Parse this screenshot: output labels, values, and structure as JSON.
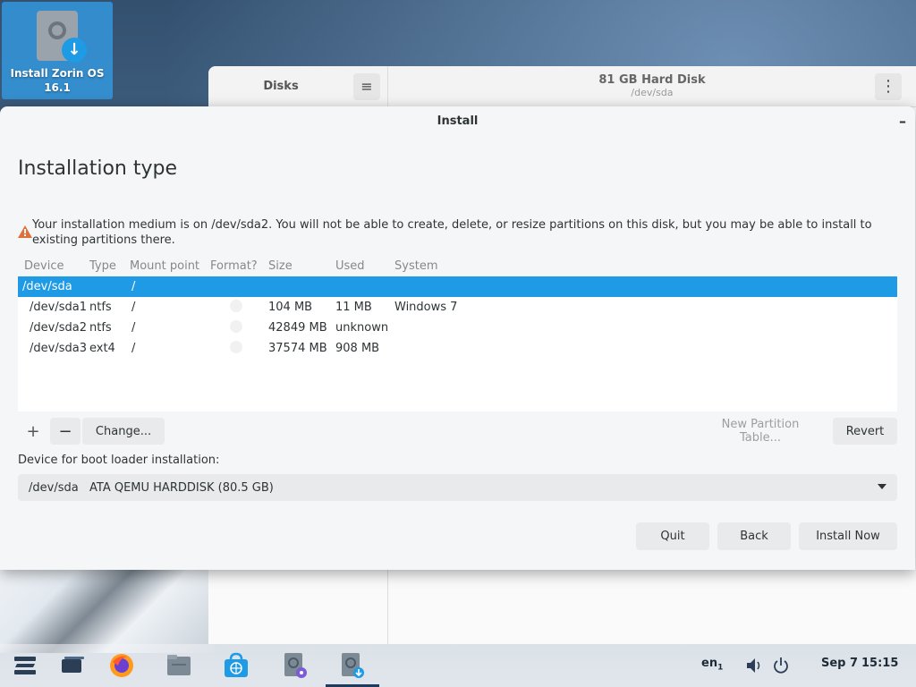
{
  "desktop": {
    "icon_label": "Install Zorin OS 16.1"
  },
  "disks_window": {
    "sidebar_title": "Disks",
    "disk_title": "81 GB Hard Disk",
    "disk_subtitle": "/dev/sda"
  },
  "install": {
    "window_title": "Install",
    "minimize_label": "–",
    "heading": "Installation type",
    "warning": "Your installation medium is on /dev/sda2. You will not be able to create, delete, or resize partitions on this disk, but you may be able to install to existing partitions there.",
    "columns": [
      "Device",
      "Type",
      "Mount point",
      "Format?",
      "Size",
      "Used",
      "System"
    ],
    "rows": [
      {
        "device": "/dev/sda",
        "type": "",
        "mount": "/",
        "size": "",
        "used": "",
        "system": ""
      },
      {
        "device": "/dev/sda1",
        "type": "ntfs",
        "mount": "/",
        "size": "104 MB",
        "used": "11 MB",
        "system": "Windows 7"
      },
      {
        "device": "/dev/sda2",
        "type": "ntfs",
        "mount": "/",
        "size": "42849 MB",
        "used": "unknown",
        "system": ""
      },
      {
        "device": "/dev/sda3",
        "type": "ext4",
        "mount": "/",
        "size": "37574 MB",
        "used": "908 MB",
        "system": ""
      }
    ],
    "toolbar": {
      "add_label": "+",
      "remove_label": "−",
      "change_label": "Change...",
      "new_table_label": "New Partition Table...",
      "revert_label": "Revert"
    },
    "boot_label": "Device for boot loader installation:",
    "boot_device": "/dev/sda",
    "boot_description": "ATA QEMU HARDDISK (80.5 GB)",
    "buttons": {
      "quit": "Quit",
      "back": "Back",
      "install_now": "Install Now"
    }
  },
  "taskbar": {
    "keyboard_layout": "en",
    "keyboard_layout_sub": "1",
    "date": "Sep 7",
    "time": "15:15"
  },
  "colors": {
    "selection": "#1f9be5",
    "warning": "#e0703a"
  }
}
